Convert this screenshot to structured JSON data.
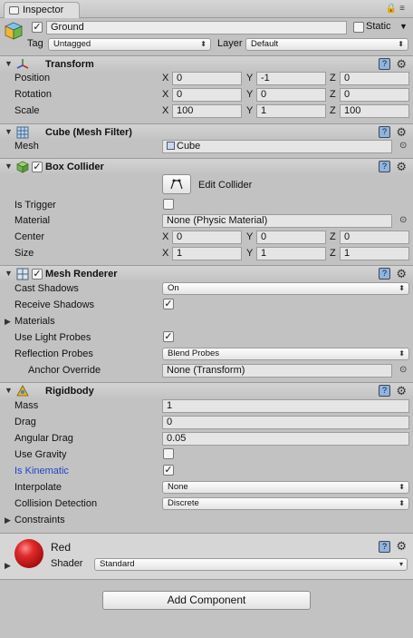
{
  "tab": {
    "title": "Inspector"
  },
  "object": {
    "name": "Ground",
    "active": true,
    "static_label": "Static",
    "static": false,
    "tag_label": "Tag",
    "tag_value": "Untagged",
    "layer_label": "Layer",
    "layer_value": "Default"
  },
  "axes": {
    "x": "X",
    "y": "Y",
    "z": "Z"
  },
  "transform": {
    "title": "Transform",
    "position_label": "Position",
    "rotation_label": "Rotation",
    "scale_label": "Scale",
    "position": {
      "x": "0",
      "y": "-1",
      "z": "0"
    },
    "rotation": {
      "x": "0",
      "y": "0",
      "z": "0"
    },
    "scale": {
      "x": "100",
      "y": "1",
      "z": "100"
    }
  },
  "mesh_filter": {
    "title": "Cube (Mesh Filter)",
    "mesh_label": "Mesh",
    "mesh_value": "Cube"
  },
  "box_collider": {
    "title": "Box Collider",
    "enabled": true,
    "edit_label": "Edit Collider",
    "is_trigger_label": "Is Trigger",
    "is_trigger": false,
    "material_label": "Material",
    "material_value": "None (Physic Material)",
    "center_label": "Center",
    "size_label": "Size",
    "center": {
      "x": "0",
      "y": "0",
      "z": "0"
    },
    "size": {
      "x": "1",
      "y": "1",
      "z": "1"
    }
  },
  "mesh_renderer": {
    "title": "Mesh Renderer",
    "enabled": true,
    "cast_shadows_label": "Cast Shadows",
    "cast_shadows_value": "On",
    "receive_shadows_label": "Receive Shadows",
    "receive_shadows": true,
    "materials_label": "Materials",
    "use_light_probes_label": "Use Light Probes",
    "use_light_probes": true,
    "reflection_probes_label": "Reflection Probes",
    "reflection_probes_value": "Blend Probes",
    "anchor_override_label": "Anchor Override",
    "anchor_override_value": "None (Transform)"
  },
  "rigidbody": {
    "title": "Rigidbody",
    "mass_label": "Mass",
    "mass": "1",
    "drag_label": "Drag",
    "drag": "0",
    "angular_drag_label": "Angular Drag",
    "angular_drag": "0.05",
    "use_gravity_label": "Use Gravity",
    "use_gravity": false,
    "is_kinematic_label": "Is Kinematic",
    "is_kinematic": true,
    "interpolate_label": "Interpolate",
    "interpolate_value": "None",
    "collision_detection_label": "Collision Detection",
    "collision_detection_value": "Discrete",
    "constraints_label": "Constraints"
  },
  "material": {
    "name": "Red",
    "shader_label": "Shader",
    "shader_value": "Standard",
    "swatch_color": "#d8151a"
  },
  "add_component_label": "Add Component",
  "colors": {
    "kinematic_label": "#1f45c9",
    "panel_bg": "#c2c2c2"
  }
}
